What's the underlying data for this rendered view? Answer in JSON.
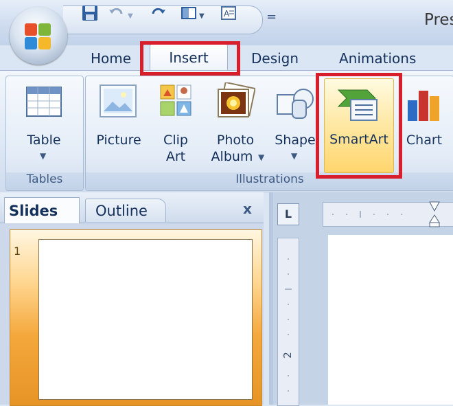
{
  "title_bar": {
    "document_title": "Pres",
    "qat_more": "="
  },
  "tabs": [
    {
      "label": "Home"
    },
    {
      "label": "Insert"
    },
    {
      "label": "Design"
    },
    {
      "label": "Animations"
    }
  ],
  "ribbon": {
    "groups": {
      "tables": {
        "label": "Tables",
        "buttons": [
          {
            "label": "Table",
            "icon": "table-icon"
          }
        ]
      },
      "illustrations": {
        "label": "Illustrations",
        "buttons": [
          {
            "label": "Picture",
            "icon": "picture-icon"
          },
          {
            "label_line1": "Clip",
            "label_line2": "Art",
            "icon": "clip-art-icon"
          },
          {
            "label_line1": "Photo",
            "label_line2": "Album",
            "icon": "photo-album-icon"
          },
          {
            "label": "Shape",
            "icon": "shapes-icon"
          },
          {
            "label": "SmartArt",
            "icon": "smartart-icon"
          },
          {
            "label": "Chart",
            "icon": "chart-icon"
          }
        ]
      }
    }
  },
  "pane": {
    "tabs": [
      {
        "label": "Slides"
      },
      {
        "label": "Outline"
      }
    ],
    "close": "x",
    "slides": [
      {
        "number": "1"
      }
    ]
  },
  "editor": {
    "corner_label": "L",
    "vertical_ruler_number": "2"
  },
  "highlight_color": "#d81e2a"
}
